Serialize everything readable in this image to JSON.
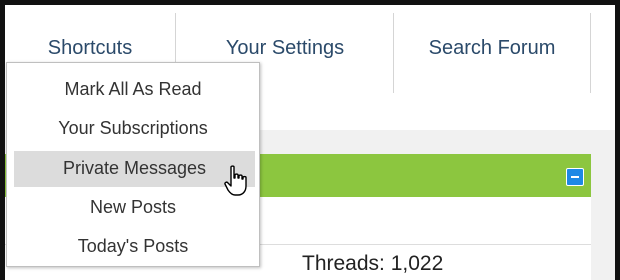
{
  "nav": {
    "tabs": [
      "Shortcuts",
      "Your Settings",
      "Search Forum"
    ]
  },
  "dropdown": {
    "items": [
      "Mark All As Read",
      "Your Subscriptions",
      "Private Messages",
      "New Posts",
      "Today's Posts"
    ],
    "hovered_index": 2
  },
  "forum": {
    "threads_text": "Threads: 1,022",
    "accent_color": "#8cc63f"
  },
  "cursor": {
    "icon": "hand-pointer-icon"
  }
}
